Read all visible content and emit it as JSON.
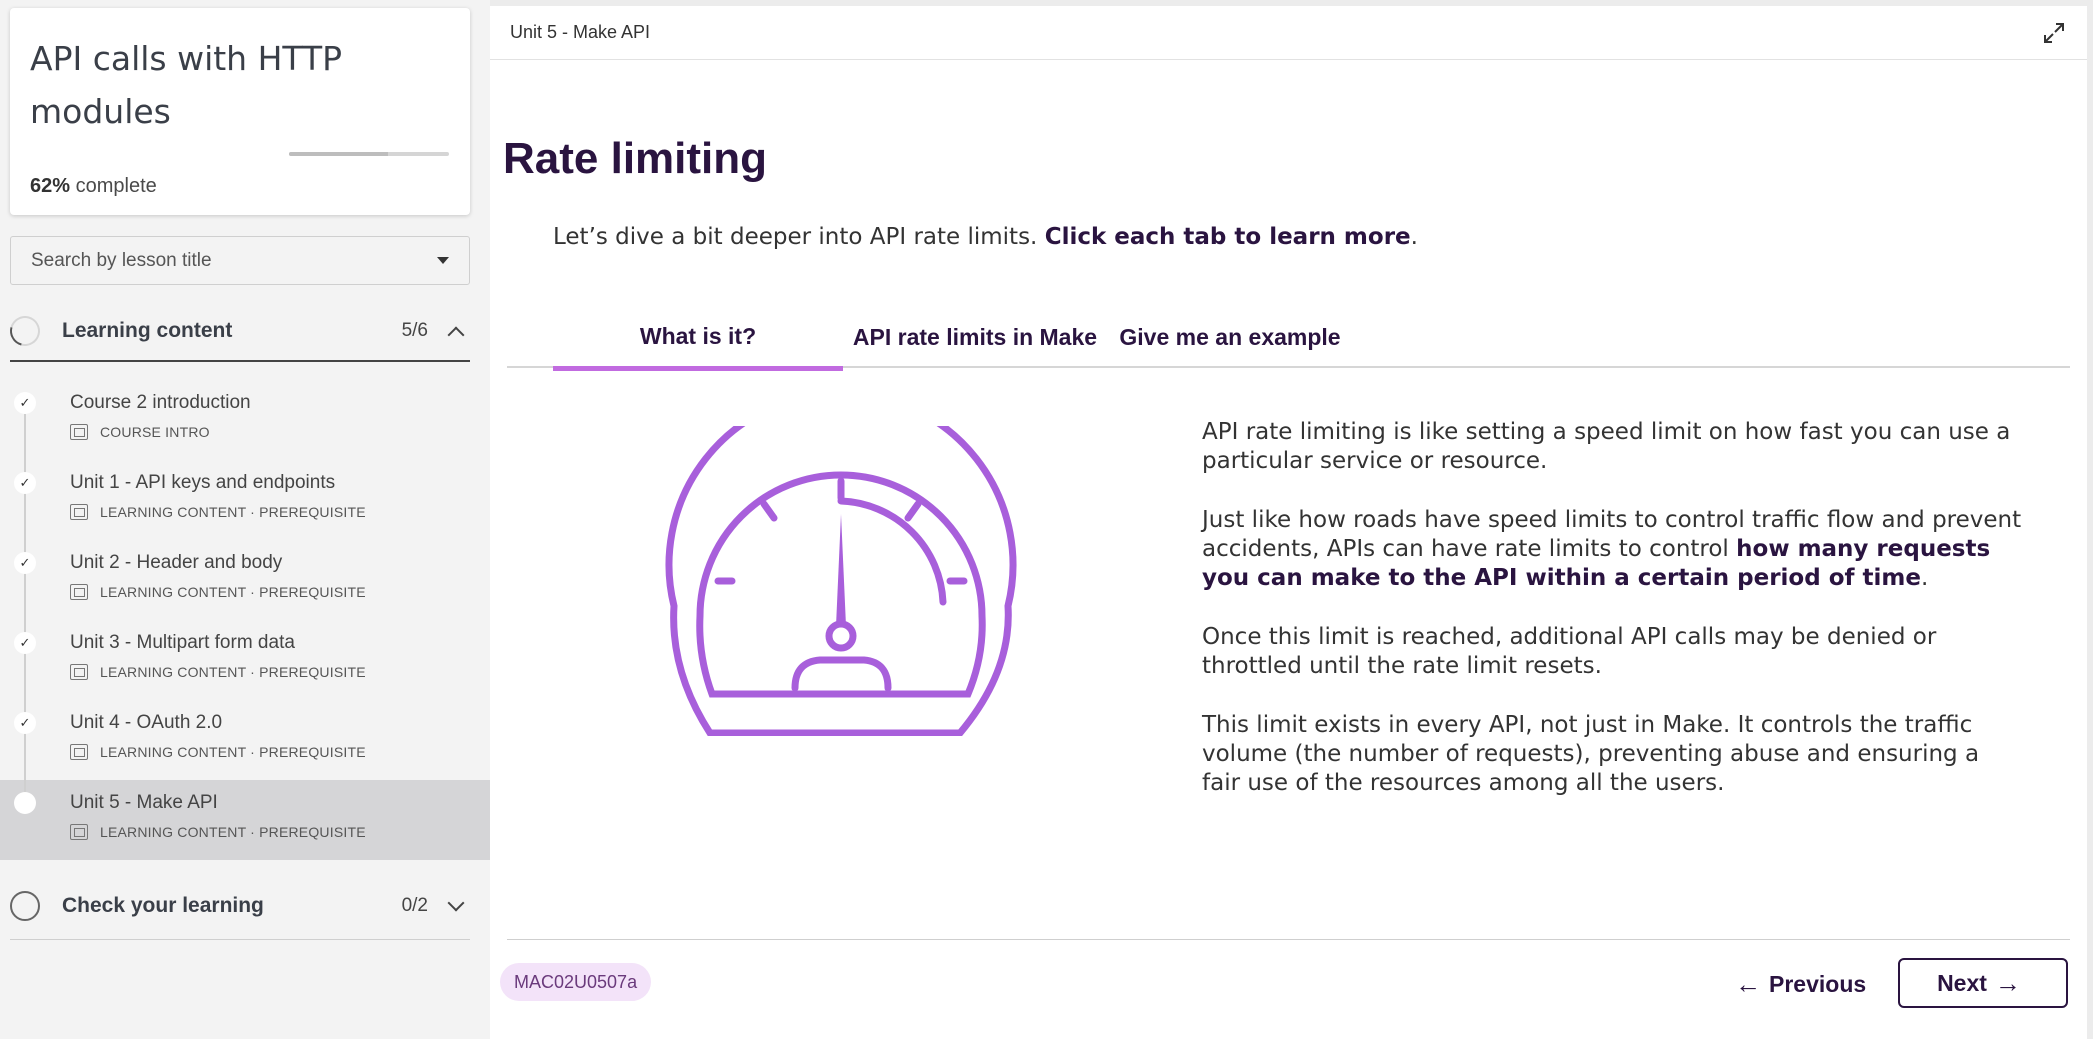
{
  "sidebar": {
    "course_title": "API calls with HTTP modules",
    "progress_percent": "62%",
    "progress_fraction": 0.62,
    "progress_suffix": "complete",
    "search_placeholder": "Search by lesson title",
    "sections": [
      {
        "label": "Learning content",
        "count": "5/6",
        "expanded": true
      },
      {
        "label": "Check your learning",
        "count": "0/2",
        "expanded": false
      }
    ],
    "lessons": [
      {
        "title": "Course 2 introduction",
        "meta": "COURSE INTRO",
        "done": true
      },
      {
        "title": "Unit 1 - API keys and endpoints",
        "meta": "LEARNING CONTENT · PREREQUISITE",
        "done": true
      },
      {
        "title": "Unit 2 - Header and body",
        "meta": "LEARNING CONTENT · PREREQUISITE",
        "done": true
      },
      {
        "title": "Unit 3 - Multipart form data",
        "meta": "LEARNING CONTENT · PREREQUISITE",
        "done": true
      },
      {
        "title": "Unit 4 - OAuth 2.0",
        "meta": "LEARNING CONTENT · PREREQUISITE",
        "done": true
      },
      {
        "title": "Unit 5 - Make API",
        "meta": "LEARNING CONTENT · PREREQUISITE",
        "done": false,
        "active": true
      }
    ],
    "check_glyph": "✓"
  },
  "main": {
    "breadcrumb": "Unit 5 - Make API",
    "title": "Rate limiting",
    "intro_plain": "Let’s dive a bit deeper into API rate limits. ",
    "intro_bold": "Click each tab to learn more",
    "intro_end": ".",
    "tabs": [
      {
        "label": "What is it?",
        "active": true
      },
      {
        "label": "API rate limits in Make",
        "active": false
      },
      {
        "label": "Give me an example",
        "active": false
      }
    ],
    "paragraphs": {
      "p1": "API rate limiting is like setting a speed limit on how fast you can use a particular service or resource.",
      "p2_a": "Just like how roads have speed limits to control traffic flow and prevent accidents, APIs can have rate limits to control ",
      "p2_bold": "how many requests you can make to the API within a certain period of time",
      "p2_end": ".",
      "p3": "Once this limit is reached, additional API calls may be denied or throttled until the rate limit resets.",
      "p4": "This limit exists in every API, not just in Make. It controls the traffic volume (the number of requests), preventing abuse and ensuring a fair use of the resources among all the users."
    },
    "illustration_icon": "speedometer-icon",
    "code": "MAC02U0507a",
    "prev_label": "Previous",
    "next_label": "Next",
    "prev_arrow": "←",
    "next_arrow": "→"
  },
  "colors": {
    "accent": "#c16be0",
    "gauge": "#a85fdb",
    "heading": "#2a1440",
    "pill_bg": "#f3e3f9"
  }
}
